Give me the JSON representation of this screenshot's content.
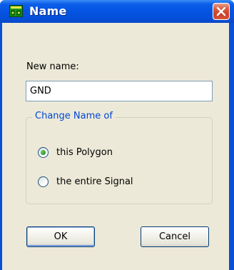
{
  "window": {
    "title": "Name",
    "title_icon": "board-chip-icon",
    "accent": "#0a4fd6"
  },
  "form": {
    "new_name_label": "New name:",
    "new_name_value": "GND",
    "group_title": "Change Name of",
    "options": [
      {
        "label": "this Polygon",
        "selected": true
      },
      {
        "label": "the entire Signal",
        "selected": false
      }
    ]
  },
  "buttons": {
    "ok": "OK",
    "cancel": "Cancel"
  }
}
